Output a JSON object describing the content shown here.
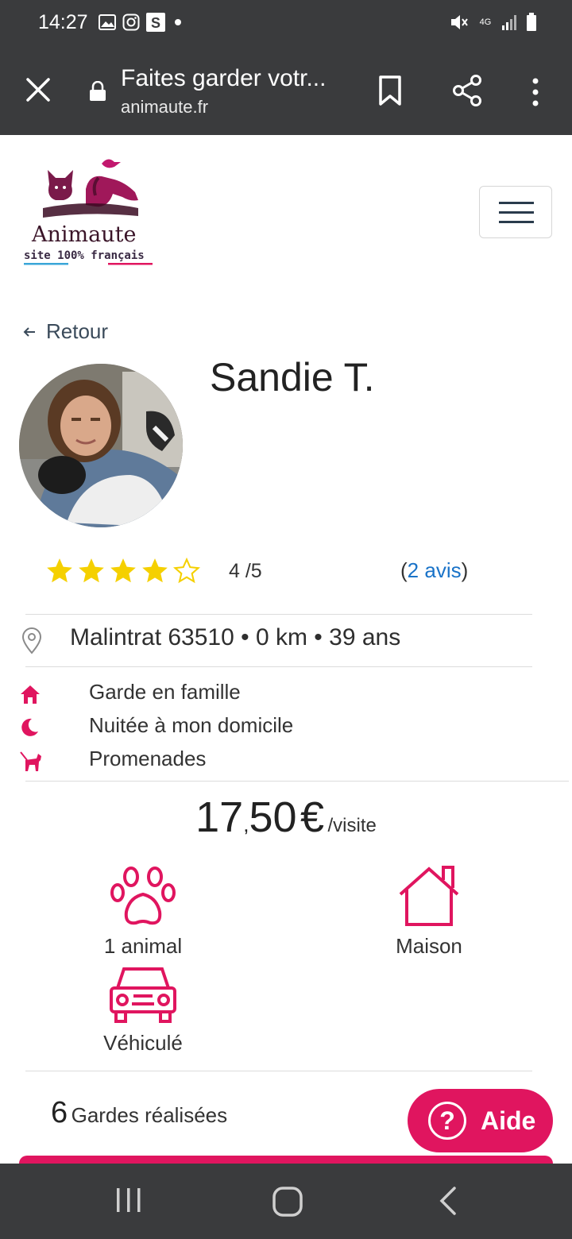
{
  "status_bar": {
    "time": "14:27",
    "network": "4G",
    "icons": [
      "gallery-icon",
      "instagram-icon",
      "s-icon",
      "dot-icon",
      "mute-icon",
      "signal-icon",
      "battery-icon"
    ]
  },
  "browser": {
    "page_title": "Faites garder votr...",
    "url": "animaute.fr",
    "icons": [
      "close-icon",
      "lock-icon",
      "bookmark-icon",
      "share-icon",
      "more-vert-icon"
    ]
  },
  "site": {
    "logo_name": "Animaute",
    "logo_tagline": "site 100% français",
    "menu_icon": "hamburger-icon"
  },
  "profile": {
    "back_label": "Retour",
    "name": "Sandie T.",
    "rating_stars": 4,
    "rating_max": 5,
    "rating_text": "4 /5",
    "reviews_open": "(",
    "reviews_link": "2 avis",
    "reviews_close": ")",
    "location": "Malintrat 63510 • 0 km • 39 ans"
  },
  "services": [
    {
      "icon": "home-icon",
      "label": "Garde en famille"
    },
    {
      "icon": "moon-icon",
      "label": "Nuitée à mon domicile"
    },
    {
      "icon": "dog-walk-icon",
      "label": "Promenades"
    }
  ],
  "price": {
    "integer": "17",
    "decimal": ",50",
    "currency": "€",
    "unit": "/visite"
  },
  "features": [
    {
      "icon": "paw-icon",
      "label": "1 animal"
    },
    {
      "icon": "house-icon",
      "label": "Maison"
    },
    {
      "icon": "car-icon",
      "label": "Véhiculé"
    }
  ],
  "stats": {
    "gardes_count": "6",
    "gardes_label": "Gardes réalisées"
  },
  "help_button": {
    "label": "Aide"
  },
  "colors": {
    "accent": "#e0155f",
    "star": "#f5d000",
    "link": "#1a73c8",
    "bar": "#3a3b3d"
  }
}
